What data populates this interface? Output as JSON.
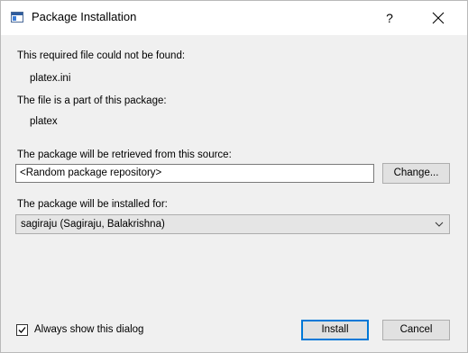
{
  "window": {
    "title": "Package Installation",
    "help_glyph": "?",
    "close_glyph": "✕",
    "icon": "package-installer-icon"
  },
  "missing_file": {
    "label": "This required file could not be found:",
    "value": "platex.ini"
  },
  "package": {
    "label": "The file is a part of this package:",
    "value": "platex"
  },
  "source": {
    "label": "The package will be retrieved from this source:",
    "value": "<Random package repository>",
    "change_button": "Change..."
  },
  "installed_for": {
    "label": "The package will be installed for:",
    "selected": "sagiraju (Sagiraju, Balakrishna)",
    "arrow_icon": "chevron-down-icon"
  },
  "footer": {
    "checkbox_label": "Always show this dialog",
    "checkbox_checked": true,
    "install_button": "Install",
    "cancel_button": "Cancel"
  },
  "colors": {
    "dialog_bg": "#f0f0f0",
    "titlebar_bg": "#ffffff",
    "default_button_border": "#0078d7",
    "button_bg": "#e1e1e1"
  }
}
